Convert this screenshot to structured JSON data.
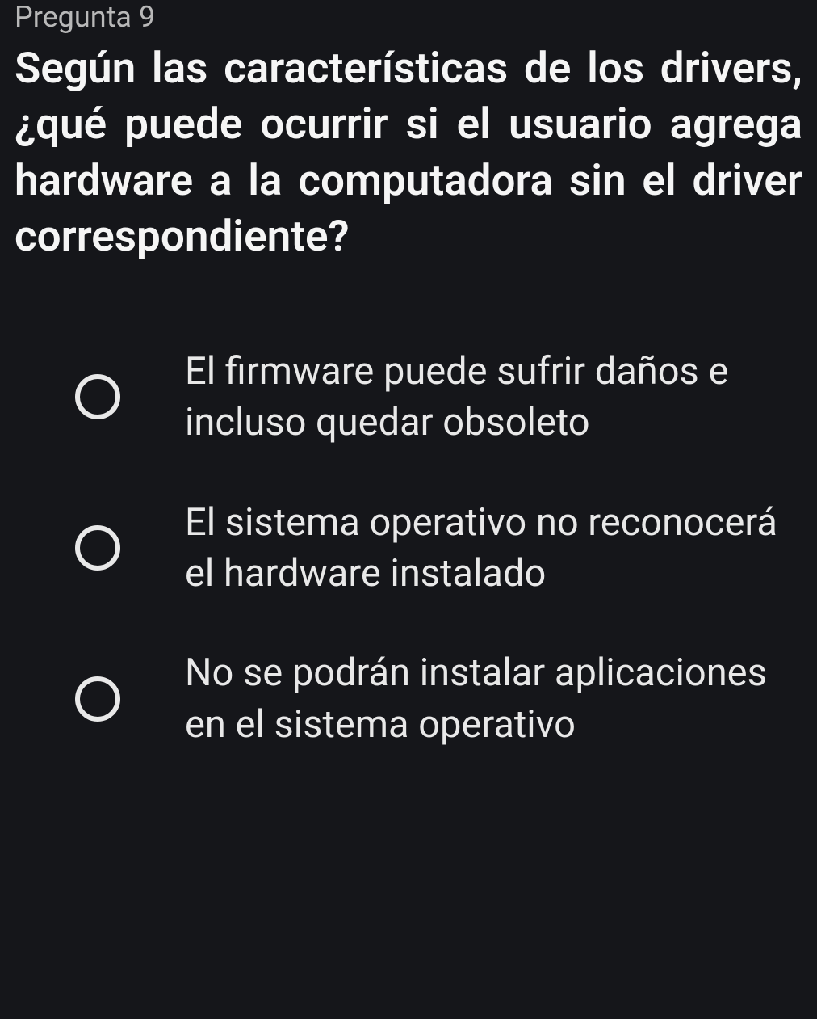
{
  "question": {
    "number_label": "Pregunta 9",
    "text": "Según las características de los drivers, ¿qué puede ocurrir si el usuario agrega hardware a la computadora sin el driver correspondiente?",
    "options": [
      {
        "text": "El firmware puede sufrir daños e incluso quedar obsoleto"
      },
      {
        "text": "El sistema operativo no reconocerá el hardware instalado"
      },
      {
        "text": "No se podrán instalar aplicaciones en el sistema operativo"
      }
    ]
  }
}
